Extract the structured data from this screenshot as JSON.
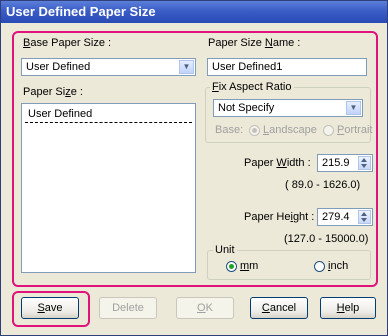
{
  "window": {
    "title": "User Defined Paper Size"
  },
  "left": {
    "base_label_u": "B",
    "base_label_rest": "ase Paper Size :",
    "base_value": "User Defined",
    "paper_size_label_pre": "Paper Si",
    "paper_size_label_u": "z",
    "paper_size_label_post": "e :",
    "paper_size_items": [
      "User Defined"
    ]
  },
  "right": {
    "name_label_pre": "Paper Size ",
    "name_label_u": "N",
    "name_label_post": "ame :",
    "name_value": "User Defined1",
    "aspect_group_pre": "",
    "aspect_group_u": "F",
    "aspect_group_post": "ix Aspect Ratio",
    "aspect_value": "Not Specify",
    "base_label": "Base:",
    "landscape_u": "L",
    "landscape_rest": "andscape",
    "portrait_u": "P",
    "portrait_rest": "ortrait",
    "width_label_pre": "Paper ",
    "width_label_u": "W",
    "width_label_post": "idth :",
    "width_value": "215.9",
    "width_range": "( 89.0 - 1626.0)",
    "height_label_pre": "Paper He",
    "height_label_u": "i",
    "height_label_post": "ght :",
    "height_value": "279.4",
    "height_range": "(127.0 - 15000.0)",
    "unit_label": "Unit",
    "mm_u": "m",
    "mm_rest": "m",
    "inch_u": "i",
    "inch_rest": "nch"
  },
  "buttons": {
    "save_u": "S",
    "save_rest": "ave",
    "delete": "Delete",
    "ok_u": "O",
    "ok_rest": "K",
    "cancel_u": "C",
    "cancel_rest": "ancel",
    "help_u": "H",
    "help_rest": "elp"
  },
  "colors": {
    "highlight": "#e0137a",
    "title_bar": "#3a5cc7"
  }
}
